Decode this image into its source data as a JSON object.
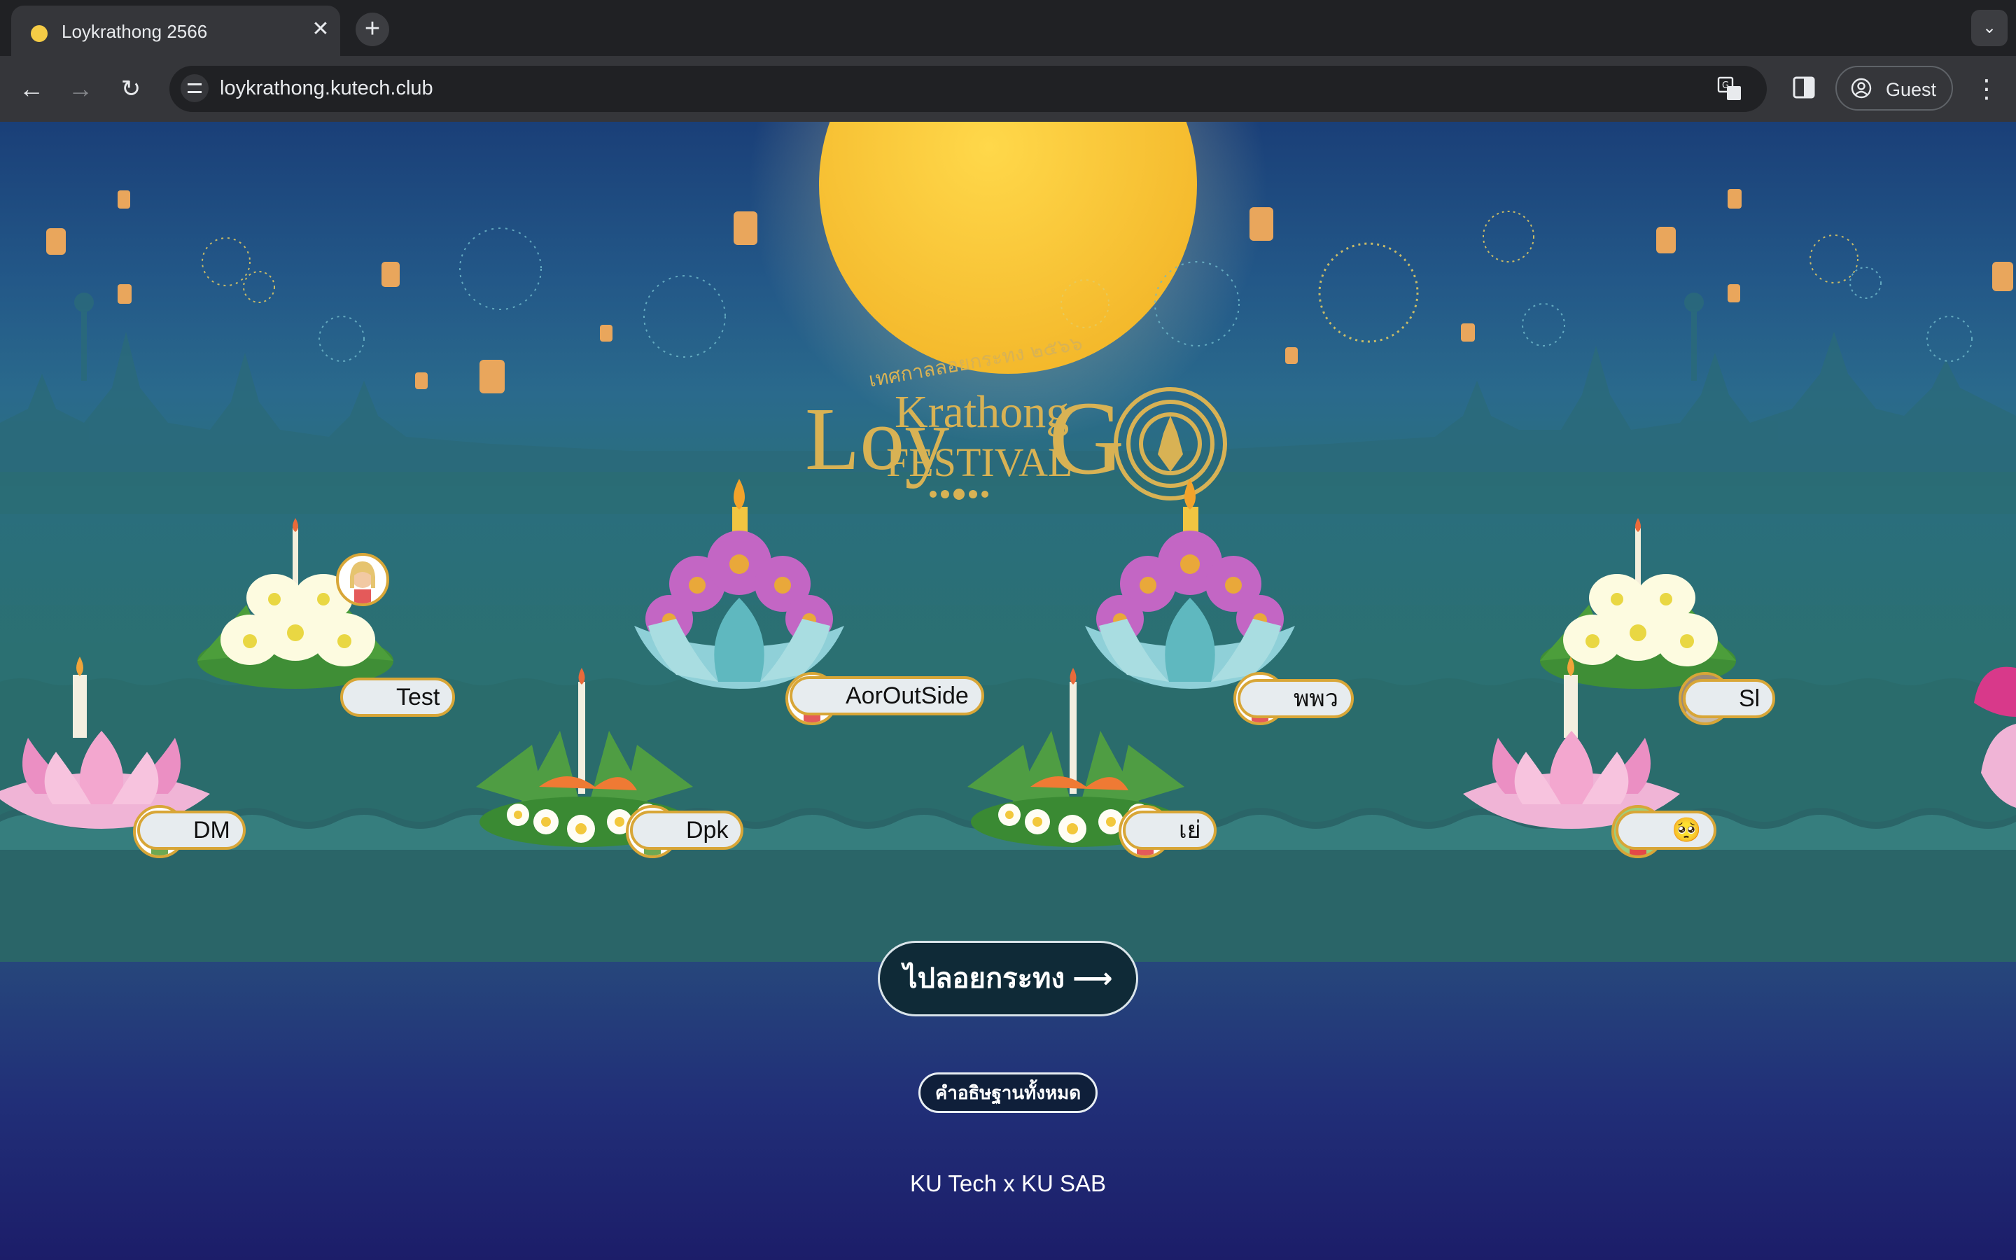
{
  "browser": {
    "tab_title": "Loykrathong 2566",
    "url": "loykrathong.kutech.club",
    "guest_label": "Guest"
  },
  "logo": {
    "subtitle": "เทศกาลลอยกระทง ๒๕๖๖",
    "line1_loy": "Loy",
    "line1_krathong": "Krathong",
    "line2_festival": "FESTIVAL",
    "go_letter": "G"
  },
  "krathongs": [
    {
      "name": "Test",
      "type": "white-flower",
      "avatar": "girl"
    },
    {
      "name": "AorOutSide",
      "type": "purple-lotus",
      "avatar": "girl"
    },
    {
      "name": "พพว",
      "type": "purple-lotus",
      "avatar": "girl"
    },
    {
      "name": "Sl",
      "type": "white-flower",
      "avatar": "photo"
    },
    {
      "name": "DM",
      "type": "pink-lotus",
      "avatar": "boy"
    },
    {
      "name": "Dpk",
      "type": "banana-leaf",
      "avatar": "boy"
    },
    {
      "name": "เย่",
      "type": "banana-leaf",
      "avatar": "girl"
    },
    {
      "name": "🥺",
      "type": "pink-lotus",
      "avatar": "cartoon"
    }
  ],
  "actions": {
    "float_button": "ไปลอยกระทง ⟶",
    "all_wishes_button": "คำอธิษฐานทั้งหมด"
  },
  "footer": "KU Tech x KU SAB",
  "colors": {
    "moon": "#f7c437",
    "gold": "#d8a637",
    "water": "#2b706f",
    "sky_top": "#1a3f78",
    "bottom": "#1c1d69"
  }
}
